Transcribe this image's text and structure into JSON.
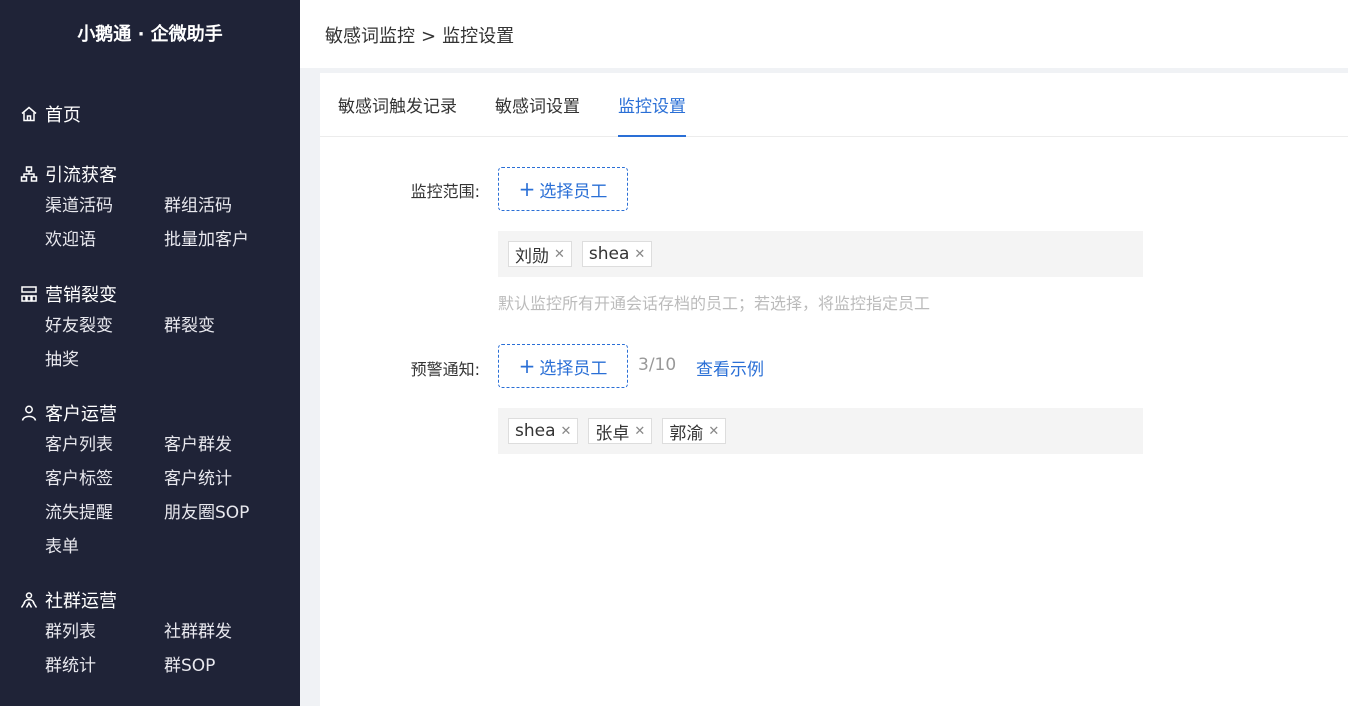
{
  "app": {
    "brand": "小鹅通 · 企微助手"
  },
  "sidebar": {
    "home": "首页",
    "groups": [
      {
        "title": "引流获客",
        "icon": "network-icon",
        "items": [
          "渠道活码",
          "群组活码",
          "欢迎语",
          "批量加客户"
        ]
      },
      {
        "title": "营销裂变",
        "icon": "org-chart-icon",
        "items": [
          "好友裂变",
          "群裂变",
          "抽奖"
        ]
      },
      {
        "title": "客户运营",
        "icon": "user-icon",
        "items": [
          "客户列表",
          "客户群发",
          "客户标签",
          "客户统计",
          "流失提醒",
          "朋友圈SOP",
          "表单"
        ]
      },
      {
        "title": "社群运营",
        "icon": "group-users-icon",
        "items": [
          "群列表",
          "社群群发",
          "群统计",
          "群SOP"
        ]
      }
    ]
  },
  "breadcrumb": {
    "parent": "敏感词监控",
    "separator": ">",
    "current": "监控设置"
  },
  "tabs": [
    "敏感词触发记录",
    "敏感词设置",
    "监控设置"
  ],
  "form": {
    "scope": {
      "label": "监控范围:",
      "button": "选择员工",
      "tags": [
        "刘勋",
        "shea"
      ],
      "hint": "默认监控所有开通会话存档的员工；若选择，将监控指定员工"
    },
    "alert": {
      "label": "预警通知:",
      "button": "选择员工",
      "count": "3/10",
      "example_link": "查看示例",
      "tags": [
        "shea",
        "张卓",
        "郭渝"
      ]
    }
  },
  "colors": {
    "sidebar_bg": "#1f2337",
    "accent": "#2a6fd6"
  }
}
